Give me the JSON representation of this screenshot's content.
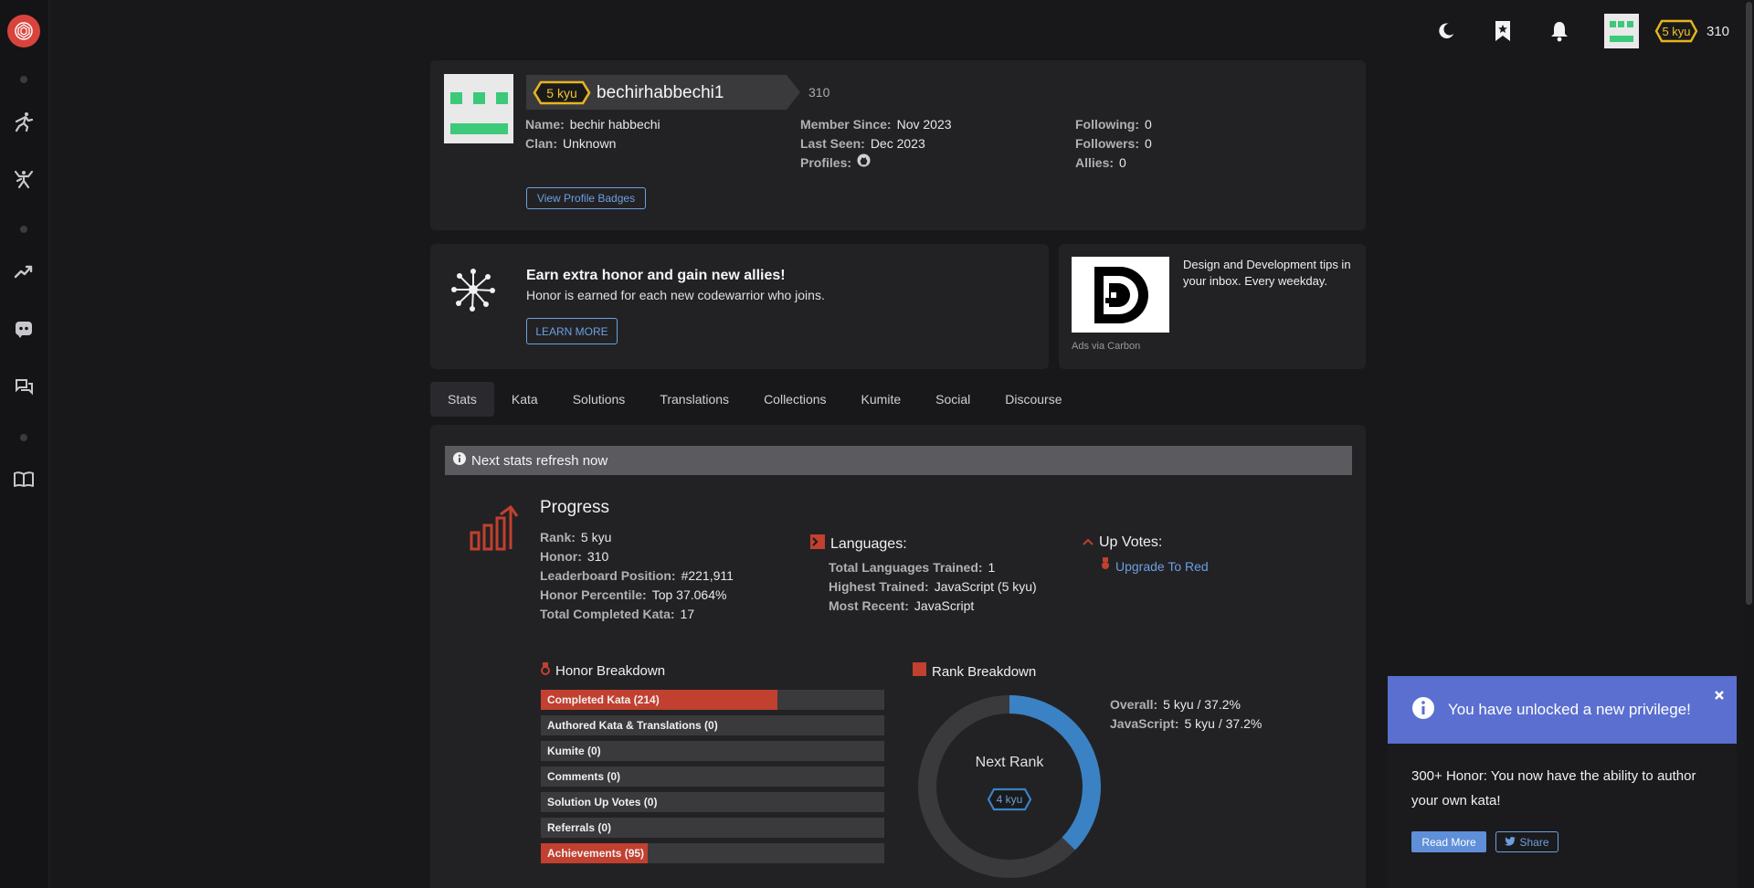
{
  "colors": {
    "brand": "#d8443d",
    "accent_blue": "#6d9fe0",
    "kyu_yellow": "#e6b422",
    "honor_red": "#c1402f",
    "rank_blue": "#3b82c4",
    "notif_blue": "#5a6fd0"
  },
  "sidebar": {
    "icons": [
      "codewars-logo-icon",
      "training-icon",
      "practice-icon",
      "leaderboard-icon",
      "discord-icon",
      "chat-icon",
      "docs-icon"
    ]
  },
  "topbar": {
    "icons": [
      "moon-icon",
      "bookmark-icon",
      "bell-icon"
    ],
    "rank": "5 kyu",
    "honor": "310"
  },
  "profile": {
    "rank": "5 kyu",
    "username": "bechirhabbechi1",
    "honor": "310",
    "name_label": "Name:",
    "name": "bechir habbechi",
    "clan_label": "Clan:",
    "clan": "Unknown",
    "member_since_label": "Member Since:",
    "member_since": "Nov 2023",
    "last_seen_label": "Last Seen:",
    "last_seen": "Dec 2023",
    "profiles_label": "Profiles:",
    "following_label": "Following:",
    "following": "0",
    "followers_label": "Followers:",
    "followers": "0",
    "allies_label": "Allies:",
    "allies": "0",
    "view_badges": "View Profile Badges"
  },
  "promo": {
    "title": "Earn extra honor and gain new allies!",
    "text": "Honor is earned for each new codewarrior who joins.",
    "button": "LEARN MORE"
  },
  "ad": {
    "text": "Design and Development tips in your inbox. Every weekday.",
    "via": "Ads via Carbon"
  },
  "tabs": [
    "Stats",
    "Kata",
    "Solutions",
    "Translations",
    "Collections",
    "Kumite",
    "Social",
    "Discourse"
  ],
  "stats": {
    "refresh": "Next stats refresh now",
    "progress_title": "Progress",
    "rank_label": "Rank:",
    "rank": "5 kyu",
    "honor_label": "Honor:",
    "honor": "310",
    "leaderboard_label": "Leaderboard Position:",
    "leaderboard": "#221,911",
    "percentile_label": "Honor Percentile:",
    "percentile": "Top 37.064%",
    "completed_label": "Total Completed Kata:",
    "completed": "17",
    "languages_title": "Languages:",
    "langs_trained_label": "Total Languages Trained:",
    "langs_trained": "1",
    "highest_label": "Highest Trained:",
    "highest": "JavaScript (5 kyu)",
    "recent_label": "Most Recent:",
    "recent": "JavaScript",
    "upvotes_title": "Up Votes:",
    "upgrade": "Upgrade To Red",
    "honor_breakdown_title": "Honor Breakdown",
    "honor_breakdown": [
      {
        "label": "Completed Kata (214)",
        "fraction": 0.69
      },
      {
        "label": "Authored Kata & Translations (0)",
        "fraction": 0
      },
      {
        "label": "Kumite (0)",
        "fraction": 0
      },
      {
        "label": "Comments (0)",
        "fraction": 0
      },
      {
        "label": "Solution Up Votes (0)",
        "fraction": 0
      },
      {
        "label": "Referrals (0)",
        "fraction": 0
      },
      {
        "label": "Achievements (95)",
        "fraction": 0.31
      }
    ],
    "rank_breakdown_title": "Rank Breakdown",
    "overall_label": "Overall:",
    "overall": "5 kyu / 37.2%",
    "js_label": "JavaScript:",
    "js": "5 kyu / 37.2%",
    "next_rank": "Next Rank",
    "next_kyu": "4 kyu",
    "rank_progress": 0.372
  },
  "notification": {
    "title": "You have unlocked a new privilege!",
    "body": "300+ Honor: You now have the ability to author your own kata!",
    "read_more": "Read More",
    "share": "Share"
  }
}
